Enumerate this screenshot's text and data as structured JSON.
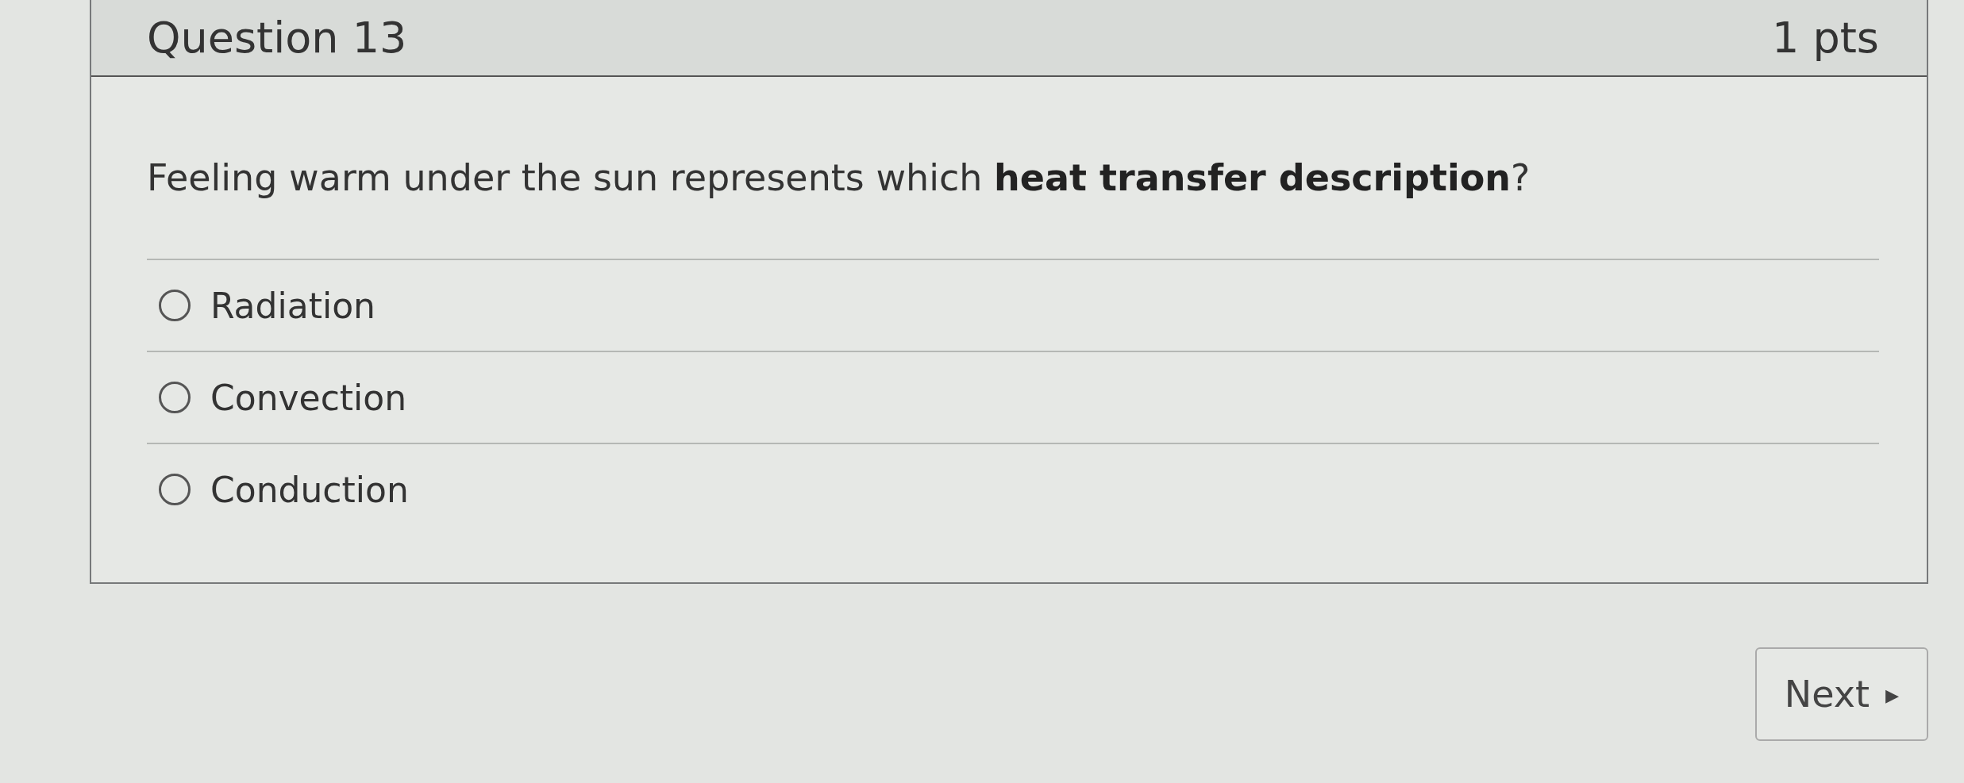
{
  "question": {
    "title": "Question 13",
    "points": "1 pts",
    "text": "Feeling warm under the sun represents which **heat transfer description**?",
    "answers": [
      {
        "label": "Radiation",
        "selected": false
      },
      {
        "label": "Convection",
        "selected": false
      },
      {
        "label": "Conduction",
        "selected": false
      }
    ]
  },
  "next_button": {
    "label": "Next",
    "icon": "▸"
  }
}
